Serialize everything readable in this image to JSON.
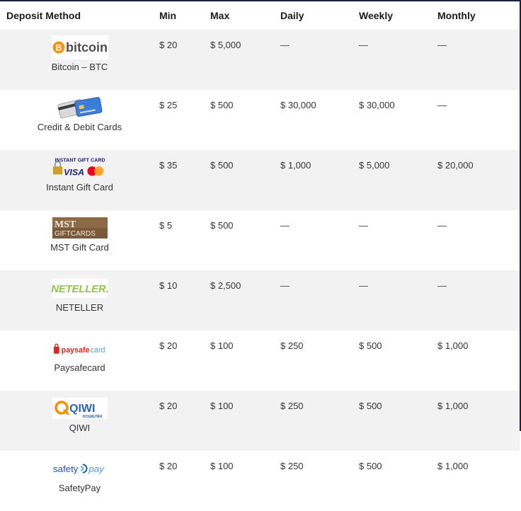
{
  "table": {
    "headers": {
      "method": "Deposit Method",
      "min": "Min",
      "max": "Max",
      "daily": "Daily",
      "weekly": "Weekly",
      "monthly": "Monthly"
    },
    "rows": [
      {
        "logo": "bitcoin-logo",
        "logo_text": "bitcoin",
        "method": "Bitcoin – BTC",
        "min": "$ 20",
        "max": "$ 5,000",
        "daily": "—",
        "weekly": "—",
        "monthly": "—"
      },
      {
        "logo": "credit-cards-logo",
        "logo_text": "",
        "method": "Credit & Debit Cards",
        "min": "$ 25",
        "max": "$ 500",
        "daily": "$ 30,000",
        "weekly": "$ 30,000",
        "monthly": "—"
      },
      {
        "logo": "instant-gift-card-logo",
        "logo_text": "INSTANT GIFT CARD",
        "logo_subtext": "VISA",
        "method": "Instant Gift Card",
        "min": "$ 35",
        "max": "$ 500",
        "daily": "$ 1,000",
        "weekly": "$ 5,000",
        "monthly": "$ 20,000"
      },
      {
        "logo": "mst-gift-cards-logo",
        "logo_text": "MST",
        "logo_subtext": "GIFTCARDS",
        "method": "MST Gift Card",
        "min": "$ 5",
        "max": "$ 500",
        "daily": "—",
        "weekly": "—",
        "monthly": "—"
      },
      {
        "logo": "neteller-logo",
        "logo_text": "NETELLER.",
        "method": "NETELLER",
        "min": "$ 10",
        "max": "$ 2,500",
        "daily": "—",
        "weekly": "—",
        "monthly": "—"
      },
      {
        "logo": "paysafecard-logo",
        "logo_text": "paysafe",
        "logo_subtext": "card",
        "method": "Paysafecard",
        "min": "$ 20",
        "max": "$ 100",
        "daily": "$ 250",
        "weekly": "$ 500",
        "monthly": "$ 1,000"
      },
      {
        "logo": "qiwi-logo",
        "logo_text": "QIWI",
        "logo_subtext": "КОШЕЛЕК",
        "method": "QIWI",
        "min": "$ 20",
        "max": "$ 100",
        "daily": "$ 250",
        "weekly": "$ 500",
        "monthly": "$ 1,000"
      },
      {
        "logo": "safetypay-logo",
        "logo_text": "safety",
        "logo_subtext": "pay",
        "method": "SafetyPay",
        "min": "$ 20",
        "max": "$ 100",
        "daily": "$ 250",
        "weekly": "$ 500",
        "monthly": "$ 1,000"
      }
    ]
  },
  "colors": {
    "frame_border": "#1c2340",
    "row_shade": "#f2f2f2",
    "bitcoin_orange": "#f7931a",
    "neteller_green": "#8dc63f",
    "paysafe_red": "#d52b1e",
    "paysafe_blue": "#4a9fd8",
    "qiwi_orange": "#ff8c00",
    "qiwi_blue": "#2b64b0",
    "safetypay_blue": "#1a56a8",
    "visa_blue": "#1a1f71",
    "mastercard_red": "#eb001b",
    "mastercard_yellow": "#f79e1b",
    "mst_brown": "#7b5a3c"
  }
}
